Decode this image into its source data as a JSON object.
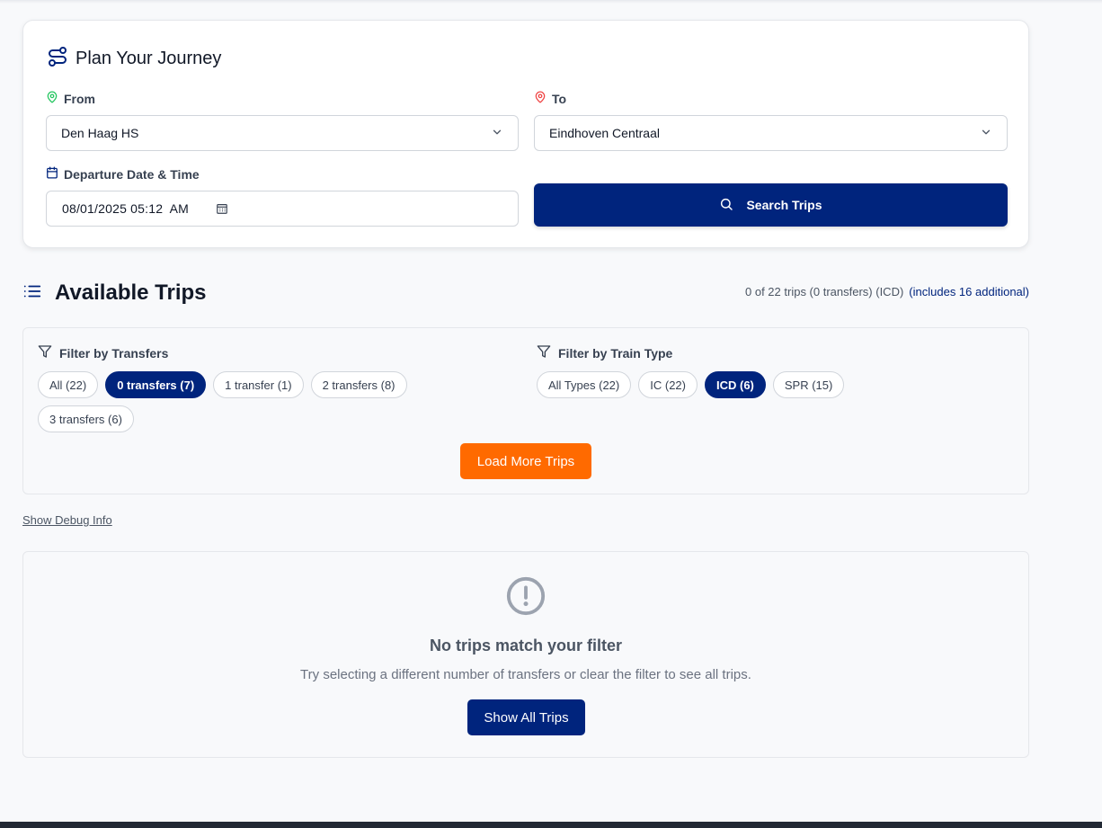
{
  "planner": {
    "title": "Plan Your Journey",
    "from_label": "From",
    "from_value": "Den Haag HS",
    "to_label": "To",
    "to_value": "Eindhoven Centraal",
    "datetime_label": "Departure Date & Time",
    "datetime_value": "08/01/2025 05:12  AM",
    "search_label": "Search Trips"
  },
  "trips": {
    "title": "Available Trips",
    "count_text": "0 of 22 trips (0 transfers) (ICD)",
    "extra_text": "(includes 16 additional)"
  },
  "filters": {
    "transfers_title": "Filter by Transfers",
    "transfers": [
      {
        "label": "All (22)",
        "active": false
      },
      {
        "label": "0 transfers (7)",
        "active": true
      },
      {
        "label": "1 transfer (1)",
        "active": false
      },
      {
        "label": "2 transfers (8)",
        "active": false
      },
      {
        "label": "3 transfers (6)",
        "active": false
      }
    ],
    "type_title": "Filter by Train Type",
    "types": [
      {
        "label": "All Types (22)",
        "active": false
      },
      {
        "label": "IC (22)",
        "active": false
      },
      {
        "label": "ICD (6)",
        "active": true
      },
      {
        "label": "SPR (15)",
        "active": false
      }
    ],
    "load_more_label": "Load More Trips"
  },
  "debug_link": "Show Debug Info",
  "empty_state": {
    "title": "No trips match your filter",
    "description": "Try selecting a different number of transfers or clear the filter to see all trips.",
    "button_label": "Show All Trips"
  },
  "colors": {
    "primary": "#00247d",
    "accent": "#ff6a00",
    "from_pin": "#22c55e",
    "to_pin": "#ef4444"
  }
}
